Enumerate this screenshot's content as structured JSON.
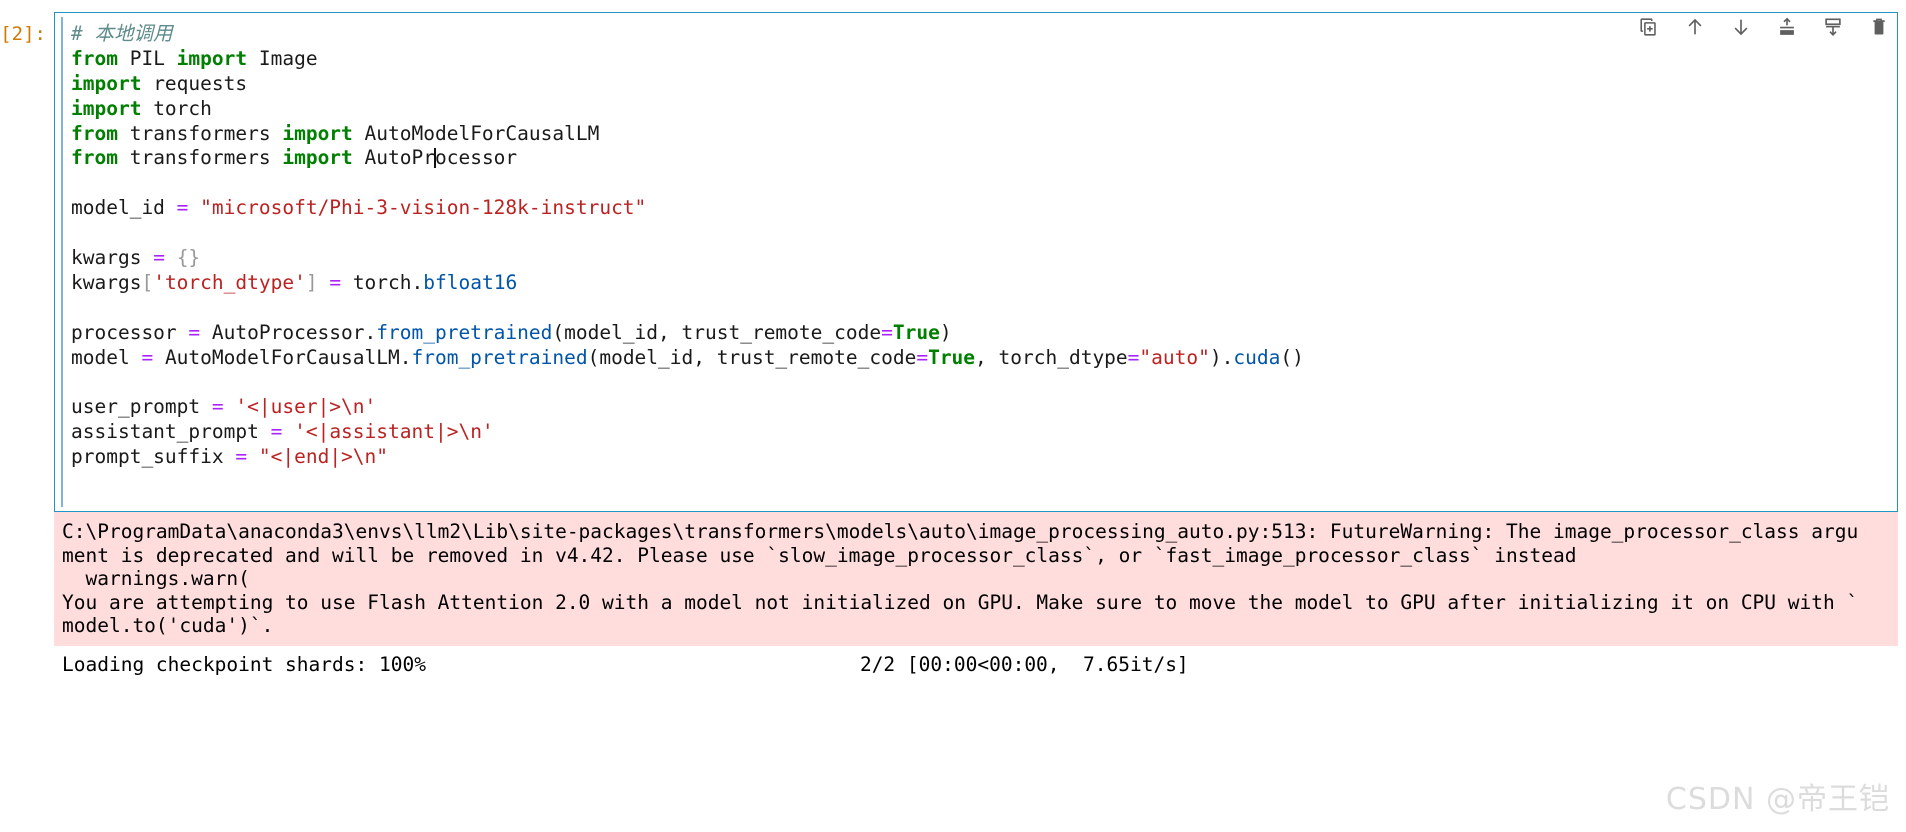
{
  "cell": {
    "prompt": "[2]:",
    "prompt_color": "#d17905",
    "border_color": "#2196c4"
  },
  "toolbar": {
    "icons": [
      {
        "name": "duplicate-cell-icon",
        "title": "Duplicate this cell"
      },
      {
        "name": "move-cell-up-icon",
        "title": "Move this cell up"
      },
      {
        "name": "move-cell-down-icon",
        "title": "Move this cell down"
      },
      {
        "name": "insert-cell-above-icon",
        "title": "Insert a cell above"
      },
      {
        "name": "insert-cell-below-icon",
        "title": "Insert a cell below"
      },
      {
        "name": "delete-cell-icon",
        "title": "Delete this cell"
      }
    ]
  },
  "code": {
    "language": "python",
    "lines": [
      [
        {
          "t": "# 本地调用",
          "c": "comment"
        }
      ],
      [
        {
          "t": "from",
          "c": "kw"
        },
        {
          "t": " PIL ",
          "c": "plain"
        },
        {
          "t": "import",
          "c": "kw"
        },
        {
          "t": " Image",
          "c": "plain"
        }
      ],
      [
        {
          "t": "import",
          "c": "kw"
        },
        {
          "t": " requests",
          "c": "plain"
        }
      ],
      [
        {
          "t": "import",
          "c": "kw"
        },
        {
          "t": " torch",
          "c": "plain"
        }
      ],
      [
        {
          "t": "from",
          "c": "kw"
        },
        {
          "t": " transformers ",
          "c": "plain"
        },
        {
          "t": "import",
          "c": "kw"
        },
        {
          "t": " AutoModelForCausalLM",
          "c": "plain"
        }
      ],
      [
        {
          "t": "from",
          "c": "kw"
        },
        {
          "t": " transformers ",
          "c": "plain"
        },
        {
          "t": "import",
          "c": "kw"
        },
        {
          "t": " AutoPr",
          "c": "plain"
        },
        {
          "t": "",
          "c": "caret"
        },
        {
          "t": "ocessor",
          "c": "plain"
        }
      ],
      [],
      [
        {
          "t": "model_id ",
          "c": "plain"
        },
        {
          "t": "=",
          "c": "op"
        },
        {
          "t": " ",
          "c": "plain"
        },
        {
          "t": "\"microsoft/Phi-3-vision-128k-instruct\"",
          "c": "str"
        }
      ],
      [],
      [
        {
          "t": "kwargs ",
          "c": "plain"
        },
        {
          "t": "=",
          "c": "op"
        },
        {
          "t": " ",
          "c": "plain"
        },
        {
          "t": "{}",
          "c": "punc"
        }
      ],
      [
        {
          "t": "kwargs",
          "c": "plain"
        },
        {
          "t": "[",
          "c": "punc"
        },
        {
          "t": "'torch_dtype'",
          "c": "str"
        },
        {
          "t": "]",
          "c": "punc"
        },
        {
          "t": " ",
          "c": "plain"
        },
        {
          "t": "=",
          "c": "op"
        },
        {
          "t": " torch.",
          "c": "plain"
        },
        {
          "t": "bfloat16",
          "c": "attr"
        }
      ],
      [],
      [
        {
          "t": "processor ",
          "c": "plain"
        },
        {
          "t": "=",
          "c": "op"
        },
        {
          "t": " AutoProcessor.",
          "c": "plain"
        },
        {
          "t": "from_pretrained",
          "c": "fn"
        },
        {
          "t": "(model_id, trust_remote_code",
          "c": "plain"
        },
        {
          "t": "=",
          "c": "op"
        },
        {
          "t": "True",
          "c": "builtin"
        },
        {
          "t": ")",
          "c": "plain"
        }
      ],
      [
        {
          "t": "model ",
          "c": "plain"
        },
        {
          "t": "=",
          "c": "op"
        },
        {
          "t": " AutoModelForCausalLM.",
          "c": "plain"
        },
        {
          "t": "from_pretrained",
          "c": "fn"
        },
        {
          "t": "(model_id, trust_remote_code",
          "c": "plain"
        },
        {
          "t": "=",
          "c": "op"
        },
        {
          "t": "True",
          "c": "builtin"
        },
        {
          "t": ", torch_dtype",
          "c": "plain"
        },
        {
          "t": "=",
          "c": "op"
        },
        {
          "t": "\"auto\"",
          "c": "str"
        },
        {
          "t": ").",
          "c": "plain"
        },
        {
          "t": "cuda",
          "c": "fn"
        },
        {
          "t": "()",
          "c": "plain"
        }
      ],
      [],
      [
        {
          "t": "user_prompt ",
          "c": "plain"
        },
        {
          "t": "=",
          "c": "op"
        },
        {
          "t": " ",
          "c": "plain"
        },
        {
          "t": "'<|user|>\\n'",
          "c": "str"
        }
      ],
      [
        {
          "t": "assistant_prompt ",
          "c": "plain"
        },
        {
          "t": "=",
          "c": "op"
        },
        {
          "t": " ",
          "c": "plain"
        },
        {
          "t": "'<|assistant|>\\n'",
          "c": "str"
        }
      ],
      [
        {
          "t": "prompt_suffix ",
          "c": "plain"
        },
        {
          "t": "=",
          "c": "op"
        },
        {
          "t": " ",
          "c": "plain"
        },
        {
          "t": "\"<|end|>\\n\"",
          "c": "str"
        }
      ]
    ]
  },
  "output": {
    "stderr_text": "C:\\ProgramData\\anaconda3\\envs\\llm2\\Lib\\site-packages\\transformers\\models\\auto\\image_processing_auto.py:513: FutureWarning: The image_processor_class argu\nment is deprecated and will be removed in v4.42. Please use `slow_image_processor_class`, or `fast_image_processor_class` instead\n  warnings.warn(\nYou are attempting to use Flash Attention 2.0 with a model not initialized on GPU. Make sure to move the model to GPU after initializing it on CPU with `\nmodel.to('cuda')`.",
    "stderr_bg": "#ffdddd",
    "progress": {
      "label": "Loading checkpoint shards: 100%",
      "percent": 100,
      "bar_color": "#2e8b3c",
      "stats": "2/2 [00:00<00:00,  7.65it/s]"
    }
  },
  "watermark": {
    "text": "CSDN @帝王铠"
  }
}
